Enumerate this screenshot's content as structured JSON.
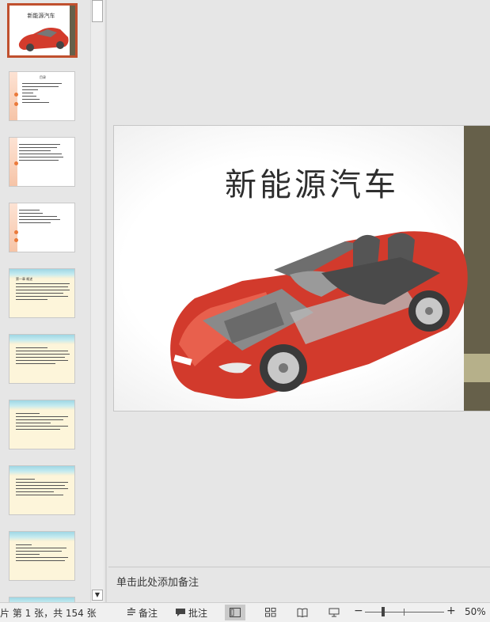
{
  "slide": {
    "title": "新能源汽车",
    "accent_dark": "#66604a",
    "accent_light": "#b6b08a"
  },
  "thumbnails": [
    {
      "style": "title",
      "selected": true,
      "mini_title": "新能源汽车"
    },
    {
      "style": "orange-list",
      "mini_title": "目录"
    },
    {
      "style": "orange-list"
    },
    {
      "style": "orange-list"
    },
    {
      "style": "wave",
      "mini_title": "第一章 概述"
    },
    {
      "style": "wave"
    },
    {
      "style": "wave"
    },
    {
      "style": "wave"
    },
    {
      "style": "wave"
    },
    {
      "style": "wave"
    }
  ],
  "notes": {
    "placeholder": "单击此处添加备注"
  },
  "statusbar": {
    "slide_counter": "片 第 1 张，共 154 张",
    "notes_label": "备注",
    "comments_label": "批注",
    "zoom_minus": "−",
    "zoom_plus": "+",
    "zoom_level": "50%",
    "zoom_percent": 50
  }
}
